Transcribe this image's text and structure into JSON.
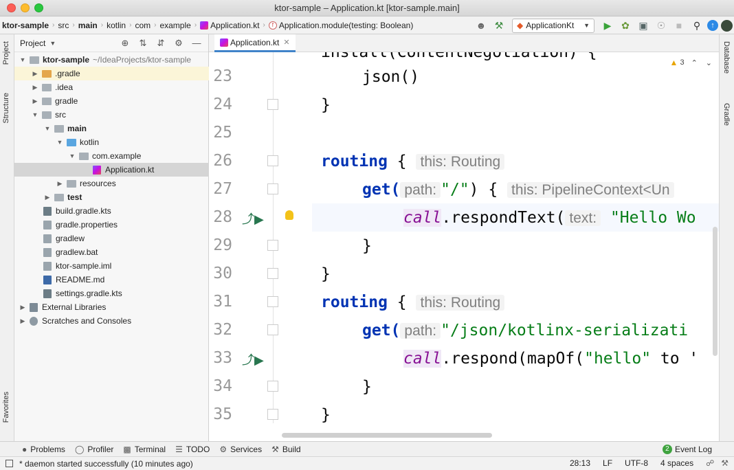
{
  "window": {
    "title": "ktor-sample – Application.kt [ktor-sample.main]"
  },
  "breadcrumbs": [
    "ktor-sample",
    "src",
    "main",
    "kotlin",
    "com",
    "example",
    "Application.kt",
    "Application.module(testing: Boolean)"
  ],
  "run_config": {
    "label": "ApplicationKt"
  },
  "left_strip": {
    "project_tab": "Project",
    "structure_tab": "Structure",
    "favorites_tab": "Favorites"
  },
  "right_strip": {
    "database_tab": "Database",
    "gradle_tab": "Gradle"
  },
  "project_panel": {
    "title": "Project",
    "root": {
      "name": "ktor-sample",
      "path": "~/IdeaProjects/ktor-sample"
    },
    "items": [
      {
        "name": ".gradle"
      },
      {
        "name": ".idea"
      },
      {
        "name": "gradle"
      },
      {
        "name": "src"
      },
      {
        "name": "main"
      },
      {
        "name": "kotlin"
      },
      {
        "name": "com.example"
      },
      {
        "name": "Application.kt"
      },
      {
        "name": "resources"
      },
      {
        "name": "test"
      },
      {
        "name": "build.gradle.kts"
      },
      {
        "name": "gradle.properties"
      },
      {
        "name": "gradlew"
      },
      {
        "name": "gradlew.bat"
      },
      {
        "name": "ktor-sample.iml"
      },
      {
        "name": "README.md"
      },
      {
        "name": "settings.gradle.kts"
      },
      {
        "name": "External Libraries"
      },
      {
        "name": "Scratches and Consoles"
      }
    ]
  },
  "editor": {
    "tab": "Application.kt",
    "warnings": "3",
    "lines": [
      "23",
      "24",
      "25",
      "26",
      "27",
      "28",
      "29",
      "30",
      "31",
      "32",
      "33",
      "34",
      "35"
    ],
    "code": {
      "l22": "install(ContentNegotiation) {",
      "l23": "json()",
      "l24": "}",
      "l26_kw": "routing",
      "l26_rest": " { ",
      "l26_hint": "this: Routing",
      "l27_kw": "get(",
      "l27_hint": "path:",
      "l27_str": "\"/\"",
      "l27_rest": ") { ",
      "l27_hint2": "this: PipelineContext<Un",
      "l28_call": "call",
      "l28_rest": ".respondText(",
      "l28_hint": "text:",
      "l28_str": "\"Hello Wo",
      "l29": "}",
      "l30": "}",
      "l31_kw": "routing",
      "l31_rest": " { ",
      "l31_hint": "this: Routing",
      "l32_kw": "get(",
      "l32_hint": "path:",
      "l32_str": "\"/json/kotlinx-serializati",
      "l33_call": "call",
      "l33_rest": ".respond(mapOf(",
      "l33_str": "\"hello\"",
      "l33_rest2": " to '",
      "l34": "}",
      "l35": "}"
    }
  },
  "bottom_tools": [
    "Problems",
    "Profiler",
    "Terminal",
    "TODO",
    "Services",
    "Build"
  ],
  "event_log": {
    "count": "2",
    "label": "Event Log"
  },
  "status": {
    "message": "* daemon started successfully (10 minutes ago)",
    "position": "28:13",
    "line_sep": "LF",
    "encoding": "UTF-8",
    "indent": "4 spaces"
  }
}
